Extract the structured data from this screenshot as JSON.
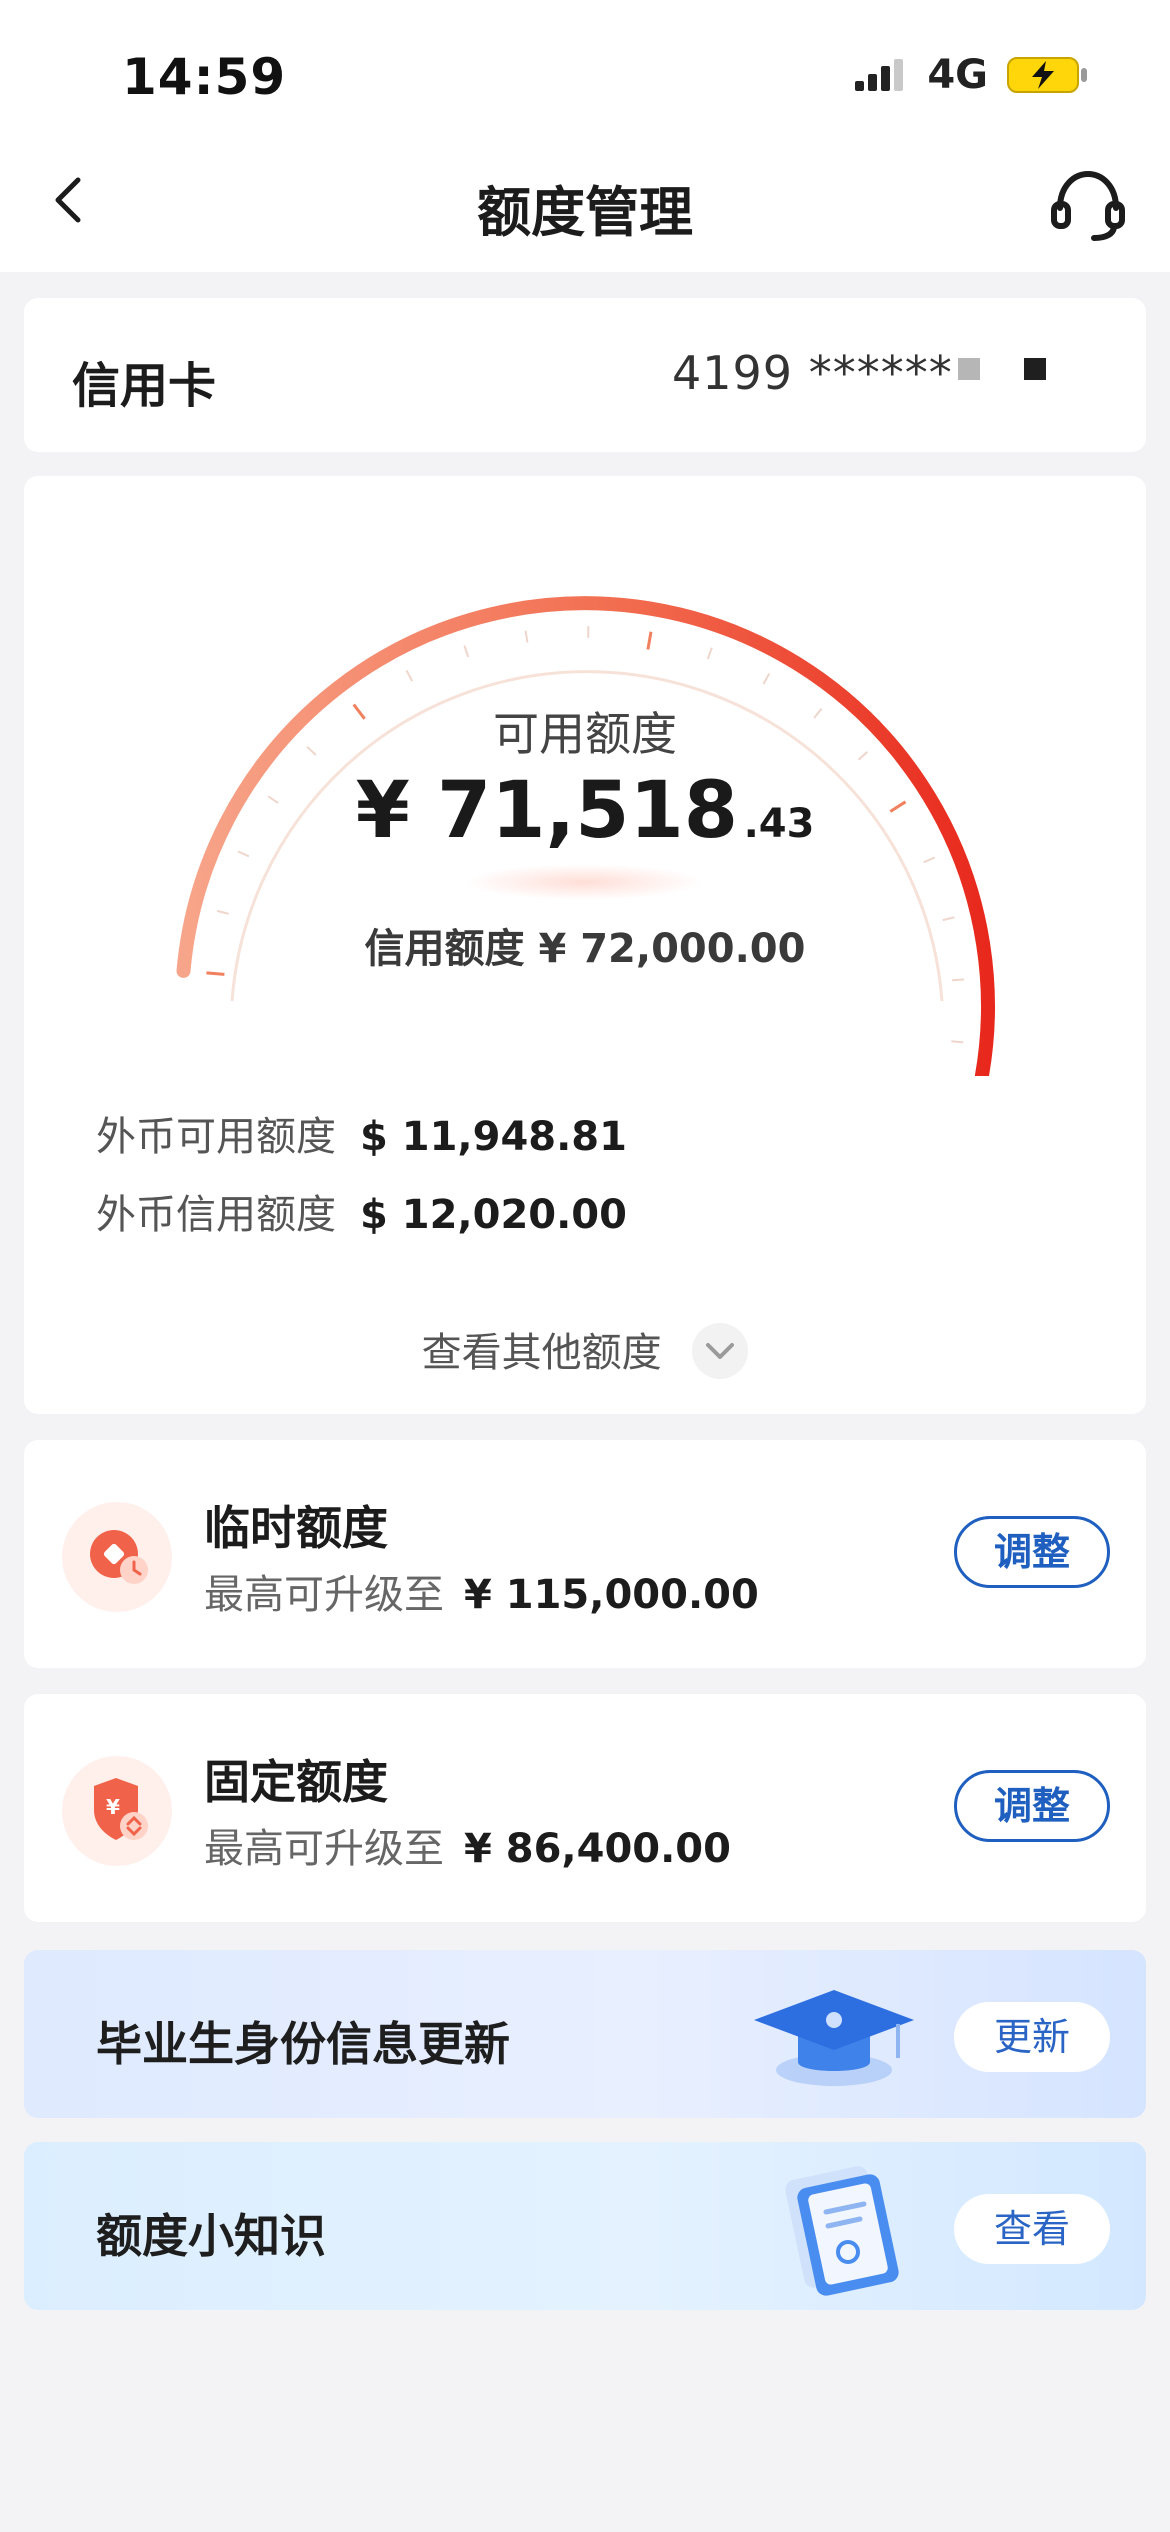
{
  "status_bar": {
    "time": "14:59",
    "network": "4G"
  },
  "nav": {
    "title": "额度管理"
  },
  "account": {
    "label": "信用卡",
    "card_number": "4199 ******"
  },
  "limit": {
    "available_label": "可用额度",
    "available_main": "¥ 71,518",
    "available_decimal": ".43",
    "credit_line": "信用额度 ¥ 72,000.00",
    "fx_available_label": "外币可用额度",
    "fx_available_value": "$ 11,948.81",
    "fx_credit_label": "外币信用额度",
    "fx_credit_value": "$ 12,020.00",
    "view_more": "查看其他额度",
    "gauge_fraction": 0.993
  },
  "temp_limit": {
    "title": "临时额度",
    "sub_label": "最高可升级至",
    "sub_value": "¥ 115,000.00",
    "button": "调整"
  },
  "fixed_limit": {
    "title": "固定额度",
    "sub_label": "最高可升级至",
    "sub_value": "¥ 86,400.00",
    "button": "调整"
  },
  "graduate_banner": {
    "title": "毕业生身份信息更新",
    "button": "更新"
  },
  "tips_banner": {
    "title": "额度小知识",
    "button": "查看"
  },
  "colors": {
    "accent_blue": "#1f5fbf",
    "gauge_start": "#f7a58a",
    "gauge_end": "#e8281c"
  },
  "icons": [
    "back-icon",
    "headset-icon",
    "signal-icon",
    "battery-charging-icon",
    "chevron-down-icon",
    "clock-coin-icon",
    "shield-yuan-icon",
    "graduation-cap-icon",
    "clipboard-icon"
  ]
}
